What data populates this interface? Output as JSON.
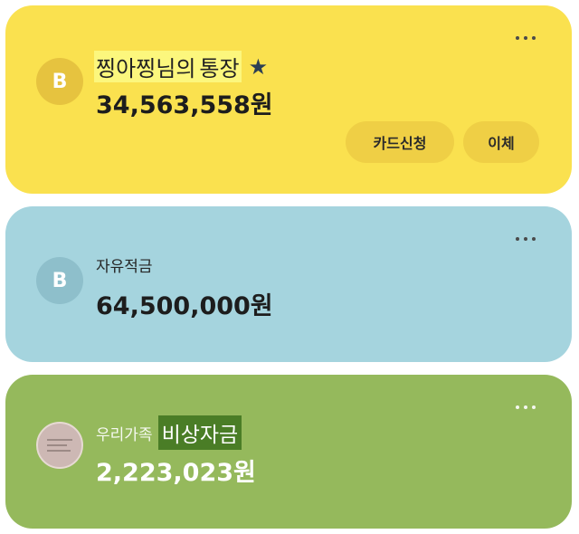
{
  "accounts": [
    {
      "logo": "B",
      "title_prefix": "찡아찡님의",
      "title_highlight": "통장",
      "star": "★",
      "amount": "34,563,558원",
      "actions": [
        "카드신청",
        "이체"
      ]
    },
    {
      "logo": "B",
      "title": "자유적금",
      "amount": "64,500,000원"
    },
    {
      "logo": "family-photo",
      "title_prefix": "우리가족",
      "title_highlight": "비상자금",
      "amount": "2,223,023원"
    }
  ],
  "colors": {
    "main_card": "#fae14f",
    "savings_card": "#a5d4de",
    "family_card": "#95b95c",
    "title_highlight": "#fcf77d",
    "family_highlight": "#4a7d26"
  },
  "icons": {
    "more": "more-dots-icon",
    "star": "star-icon",
    "bank_logo": "bank-logo-icon"
  }
}
